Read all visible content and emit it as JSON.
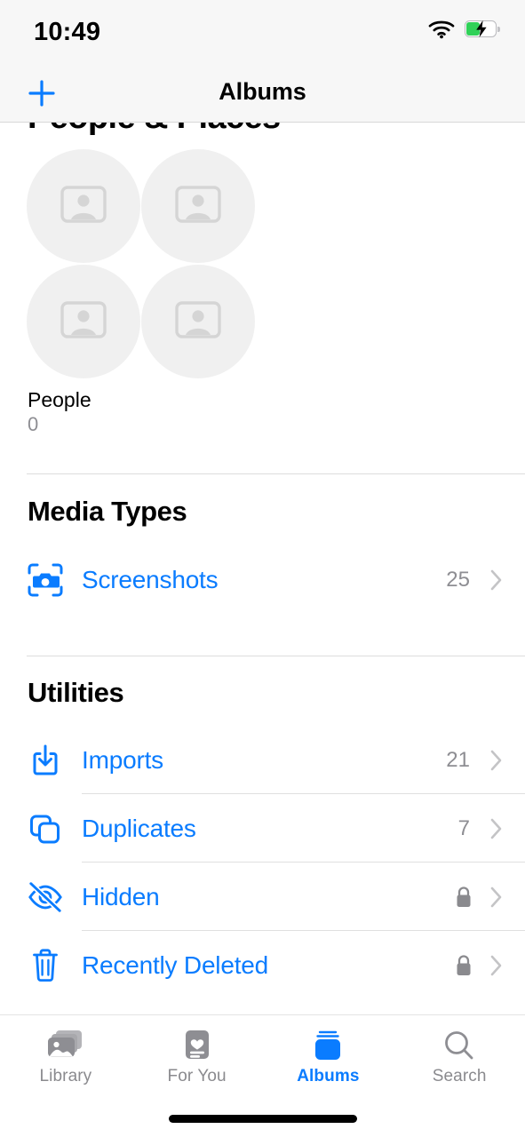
{
  "status_bar": {
    "time": "10:49",
    "wifi_icon": "wifi-icon",
    "battery_icon": "battery-charging-icon",
    "battery_level_pct": 45,
    "battery_fill_color": "#30d158"
  },
  "nav_bar": {
    "title": "Albums",
    "add_button_icon": "plus-icon"
  },
  "theme": {
    "accent": "#0a7cff",
    "secondary_text": "#8e8e93",
    "separator": "#e0e0e0",
    "placeholder_bg": "#f0f0f0"
  },
  "sections": [
    {
      "title": "People & Places",
      "clipped": true,
      "people": {
        "label": "People",
        "count": "0",
        "placeholder_icon": "person-photo-placeholder-icon",
        "placeholder_tiles": 4
      }
    },
    {
      "title": "Media Types",
      "rows": [
        {
          "label": "Screenshots",
          "icon": "screenshot-camera-icon",
          "count": "25",
          "locked": false,
          "chevron": "chevron-right-icon"
        }
      ]
    },
    {
      "title": "Utilities",
      "rows": [
        {
          "label": "Imports",
          "icon": "import-tray-arrow-down-icon",
          "count": "21",
          "locked": false,
          "chevron": "chevron-right-icon"
        },
        {
          "label": "Duplicates",
          "icon": "duplicate-squares-icon",
          "count": "7",
          "locked": false,
          "chevron": "chevron-right-icon"
        },
        {
          "label": "Hidden",
          "icon": "eye-slash-icon",
          "count": "",
          "locked": true,
          "chevron": "chevron-right-icon"
        },
        {
          "label": "Recently Deleted",
          "icon": "trash-icon",
          "count": "",
          "locked": true,
          "chevron": "chevron-right-icon"
        }
      ]
    }
  ],
  "tab_bar": {
    "items": [
      {
        "label": "Library",
        "icon": "photo-stack-icon",
        "active": false
      },
      {
        "label": "For You",
        "icon": "for-you-card-heart-icon",
        "active": false
      },
      {
        "label": "Albums",
        "icon": "albums-stack-icon",
        "active": true
      },
      {
        "label": "Search",
        "icon": "magnifier-icon",
        "active": false
      }
    ]
  }
}
